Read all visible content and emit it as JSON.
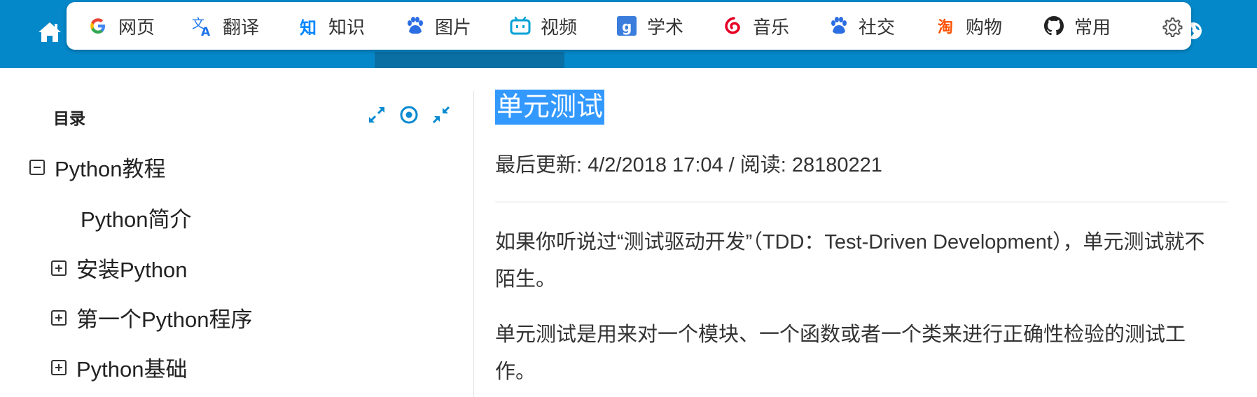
{
  "header": {
    "home_icon": "home-icon",
    "globe_icon": "globe-icon",
    "bar_color": "#0588c9"
  },
  "engines": [
    {
      "label": "网页",
      "icon": "google-icon",
      "color": "#4285f4"
    },
    {
      "label": "翻译",
      "icon": "translate-icon",
      "color": "#1a73e8"
    },
    {
      "label": "知识",
      "icon": "zhihu-icon",
      "color": "#0084ff"
    },
    {
      "label": "图片",
      "icon": "paw-icon",
      "color": "#2b6de3"
    },
    {
      "label": "视频",
      "icon": "bilibili-icon",
      "color": "#00a1d6"
    },
    {
      "label": "学术",
      "icon": "scholar-icon",
      "color": "#3b7ddd"
    },
    {
      "label": "音乐",
      "icon": "netease-icon",
      "color": "#e60026"
    },
    {
      "label": "社交",
      "icon": "paw-icon",
      "color": "#2b6de3"
    },
    {
      "label": "购物",
      "icon": "taobao-icon",
      "color": "#ff5000"
    },
    {
      "label": "常用",
      "icon": "github-icon",
      "color": "#222222"
    }
  ],
  "sidebar": {
    "title": "目录",
    "tools": [
      "expand-icon",
      "locate-icon",
      "collapse-icon"
    ],
    "items": [
      {
        "label": "Python教程",
        "state": "expanded"
      },
      {
        "label": "Python简介",
        "state": "leaf"
      },
      {
        "label": "安装Python",
        "state": "collapsed"
      },
      {
        "label": "第一个Python程序",
        "state": "collapsed"
      },
      {
        "label": "Python基础",
        "state": "collapsed"
      }
    ]
  },
  "article": {
    "title": "单元测试",
    "meta": "最后更新: 4/2/2018 17:04 / 阅读: 28180221",
    "paragraphs": [
      "如果你听说过“测试驱动开发”（TDD：Test-Driven Development），单元测试就不陌生。",
      "单元测试是用来对一个模块、一个函数或者一个类来进行正确性检验的测试工作。"
    ]
  }
}
